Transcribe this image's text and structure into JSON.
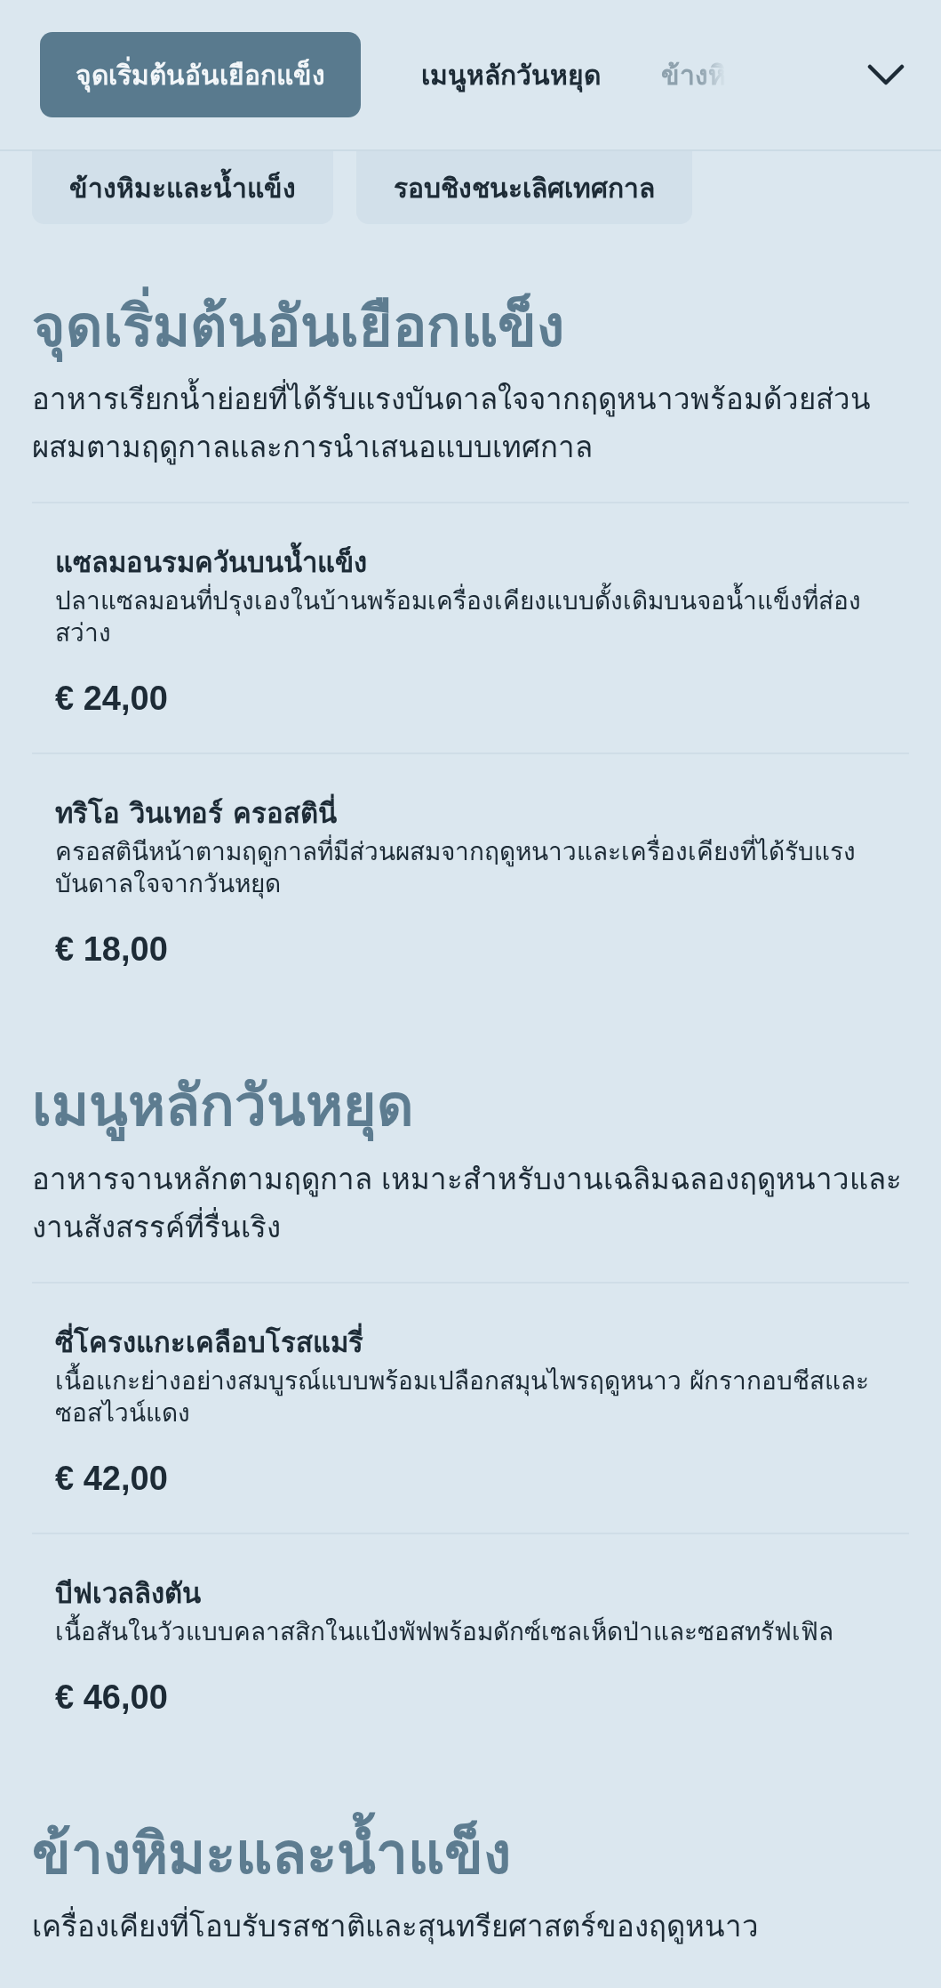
{
  "tabs": [
    {
      "label": "จุดเริ่มต้นอันเยือกแข็ง",
      "selected": true
    },
    {
      "label": "เมนูหลักวันหยุด",
      "selected": false
    },
    {
      "label": "ข้างหิ",
      "selected": false
    }
  ],
  "more_tabs": [
    {
      "label": "ข้างหิมะและน้ำแข็ง",
      "selected": false
    },
    {
      "label": "รอบชิงชนะเลิศเทศกาล",
      "selected": false
    }
  ],
  "sections": [
    {
      "title": "จุดเริ่มต้นอันเยือกแข็ง",
      "description": "อาหารเรียกน้ำย่อยที่ได้รับแรงบันดาลใจจากฤดูหนาวพร้อมด้วยส่วนผสมตามฤดูกาลและการนำเสนอแบบเทศกาล",
      "items": [
        {
          "name": "แซลมอนรมควันบนน้ำแข็ง",
          "description": "ปลาแซลมอนที่ปรุงเองในบ้านพร้อมเครื่องเคียงแบบดั้งเดิมบนจอน้ำแข็งที่ส่องสว่าง",
          "price": "€ 24,00"
        },
        {
          "name": "ทริโอ วินเทอร์ ครอสตินี่",
          "description": "ครอสตินีหน้าตามฤดูกาลที่มีส่วนผสมจากฤดูหนาวและเครื่องเคียงที่ได้รับแรงบันดาลใจจากวันหยุด",
          "price": "€ 18,00"
        }
      ]
    },
    {
      "title": "เมนูหลักวันหยุด",
      "description": "อาหารจานหลักตามฤดูกาล เหมาะสำหรับงานเฉลิมฉลองฤดูหนาวและงานสังสรรค์ที่รื่นเริง",
      "items": [
        {
          "name": "ซี่โครงแกะเคลือบโรสแมรี่",
          "description": "เนื้อแกะย่างอย่างสมบูรณ์แบบพร้อมเปลือกสมุนไพรฤดูหนาว ผักรากอบชีสและซอสไวน์แดง",
          "price": "€ 42,00"
        },
        {
          "name": "บีฟเวลลิงตัน",
          "description": "เนื้อสันในวัวแบบคลาสสิกในแป้งพัฟพร้อมดักซ์เซลเห็ดป่าและซอสทรัฟเฟิล",
          "price": "€ 46,00"
        }
      ]
    },
    {
      "title": "ข้างหิมะและน้ำแข็ง",
      "description": "เครื่องเคียงที่โอบรับรสชาติและสุนทรียศาสตร์ของฤดูหนาว"
    }
  ]
}
